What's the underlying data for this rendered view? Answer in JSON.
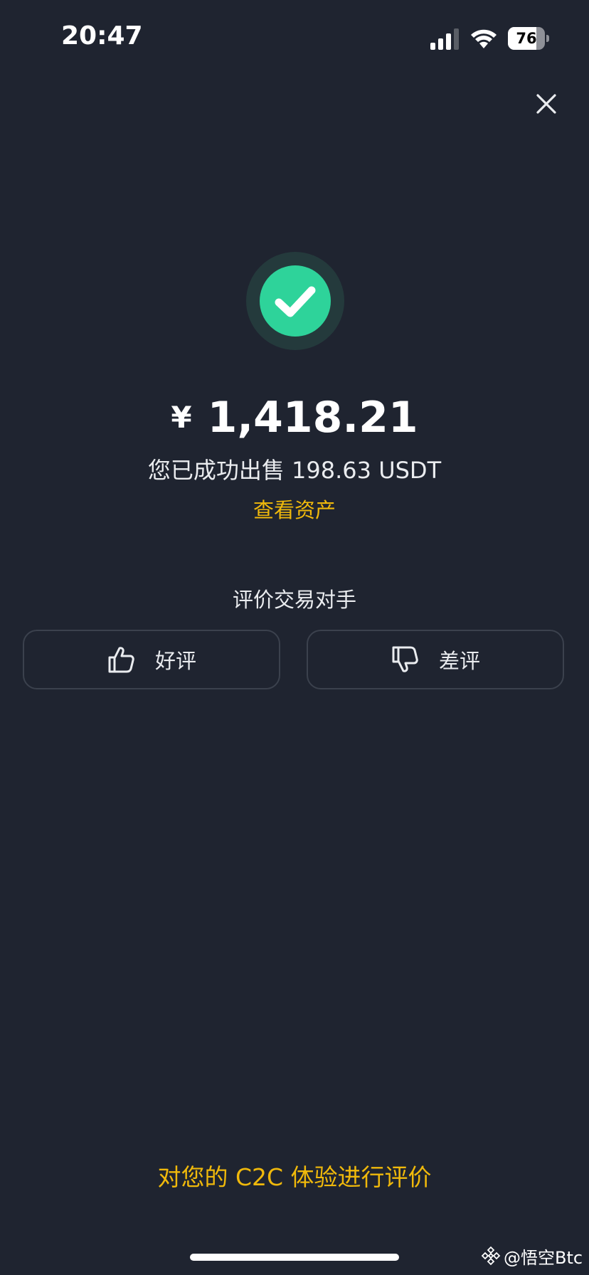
{
  "status_bar": {
    "time": "20:47",
    "battery_level": "76",
    "battery_fraction": 0.76
  },
  "amount": {
    "currency_symbol": "¥",
    "value": "1,418.21"
  },
  "sold_message": "您已成功出售 198.63 USDT",
  "view_assets_label": "查看资产",
  "rate_counterparty": {
    "title": "评价交易对手",
    "good_label": "好评",
    "bad_label": "差评"
  },
  "experience_link": "对您的 C2C 体验进行评价",
  "watermark": "@悟空Btc",
  "colors": {
    "background": "#1f2430",
    "accent": "#f0b90b",
    "success": "#2ed39a",
    "success_ring": "#243a3c",
    "button_border": "#3b414d"
  }
}
